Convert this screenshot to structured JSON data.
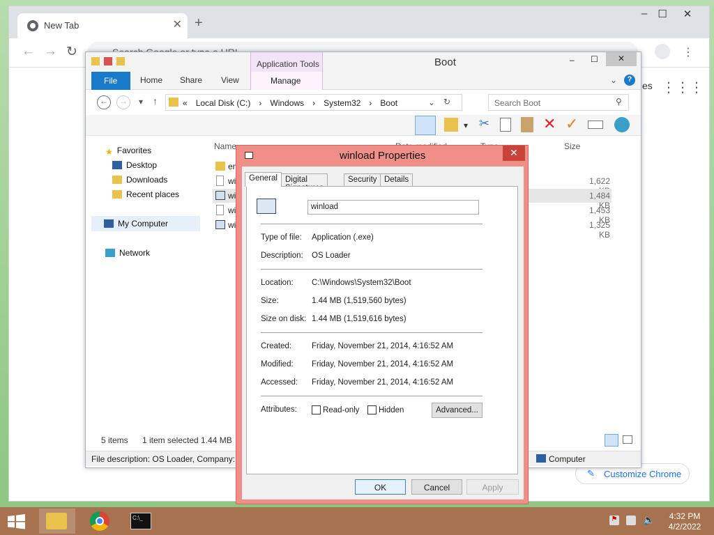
{
  "chrome": {
    "tab_title": "New Tab",
    "omnibox_placeholder": "Search Google or type a URL",
    "customize_label": "Customize Chrome",
    "partial_text": "es"
  },
  "explorer": {
    "title": "Boot",
    "app_tools": "Application Tools",
    "ribbon_tabs": [
      "File",
      "Home",
      "Share",
      "View",
      "Manage"
    ],
    "breadcrumb": [
      "«",
      "Local Disk (C:)",
      "›",
      "Windows",
      "›",
      "System32",
      "›",
      "Boot"
    ],
    "search_placeholder": "Search Boot",
    "columns": {
      "name": "Name",
      "date": "Date modified",
      "type": "Type",
      "size": "Size"
    },
    "nav": {
      "favorites": "Favorites",
      "desktop": "Desktop",
      "downloads": "Downloads",
      "recent": "Recent places",
      "computer": "My Computer",
      "network": "Network"
    },
    "files": [
      {
        "name": "en",
        "size": ""
      },
      {
        "name": "wi",
        "size": "1,622 KB"
      },
      {
        "name": "wi",
        "size": "1,484 KB"
      },
      {
        "name": "wi",
        "size": "1,453 KB"
      },
      {
        "name": "wi",
        "size": "1,325 KB"
      }
    ],
    "status_items": "5 items",
    "status_selected": "1 item selected  1.44 MB",
    "description_bar": "File description: OS Loader, Company: N",
    "computer_label": "Computer"
  },
  "properties": {
    "title": "winload Properties",
    "tabs": [
      "General",
      "Digital Signatures",
      "Security",
      "Details"
    ],
    "filename": "winload",
    "type_label": "Type of file:",
    "type_value": "Application (.exe)",
    "desc_label": "Description:",
    "desc_value": "OS Loader",
    "location_label": "Location:",
    "location_value": "C:\\Windows\\System32\\Boot",
    "size_label": "Size:",
    "size_value": "1.44 MB (1,519,560 bytes)",
    "sizedisk_label": "Size on disk:",
    "sizedisk_value": "1.44 MB (1,519,616 bytes)",
    "created_label": "Created:",
    "created_value": "Friday, November 21, 2014, 4:16:52 AM",
    "modified_label": "Modified:",
    "modified_value": "Friday, November 21, 2014, 4:16:52 AM",
    "accessed_label": "Accessed:",
    "accessed_value": "Friday, November 21, 2014, 4:16:52 AM",
    "attributes_label": "Attributes:",
    "readonly_label": "Read-only",
    "hidden_label": "Hidden",
    "advanced_label": "Advanced...",
    "ok_label": "OK",
    "cancel_label": "Cancel",
    "apply_label": "Apply"
  },
  "taskbar": {
    "time": "4:32 PM",
    "date": "4/2/2022",
    "prompt_text": "C:\\_"
  }
}
